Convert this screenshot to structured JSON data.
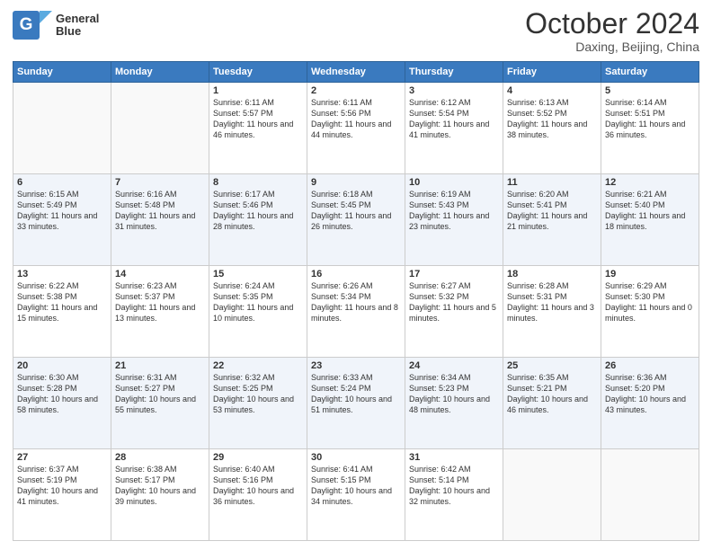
{
  "logo": {
    "line1": "General",
    "line2": "Blue"
  },
  "title": "October 2024",
  "location": "Daxing, Beijing, China",
  "headers": [
    "Sunday",
    "Monday",
    "Tuesday",
    "Wednesday",
    "Thursday",
    "Friday",
    "Saturday"
  ],
  "weeks": [
    [
      {
        "day": "",
        "info": ""
      },
      {
        "day": "",
        "info": ""
      },
      {
        "day": "1",
        "info": "Sunrise: 6:11 AM\nSunset: 5:57 PM\nDaylight: 11 hours and 46 minutes."
      },
      {
        "day": "2",
        "info": "Sunrise: 6:11 AM\nSunset: 5:56 PM\nDaylight: 11 hours and 44 minutes."
      },
      {
        "day": "3",
        "info": "Sunrise: 6:12 AM\nSunset: 5:54 PM\nDaylight: 11 hours and 41 minutes."
      },
      {
        "day": "4",
        "info": "Sunrise: 6:13 AM\nSunset: 5:52 PM\nDaylight: 11 hours and 38 minutes."
      },
      {
        "day": "5",
        "info": "Sunrise: 6:14 AM\nSunset: 5:51 PM\nDaylight: 11 hours and 36 minutes."
      }
    ],
    [
      {
        "day": "6",
        "info": "Sunrise: 6:15 AM\nSunset: 5:49 PM\nDaylight: 11 hours and 33 minutes."
      },
      {
        "day": "7",
        "info": "Sunrise: 6:16 AM\nSunset: 5:48 PM\nDaylight: 11 hours and 31 minutes."
      },
      {
        "day": "8",
        "info": "Sunrise: 6:17 AM\nSunset: 5:46 PM\nDaylight: 11 hours and 28 minutes."
      },
      {
        "day": "9",
        "info": "Sunrise: 6:18 AM\nSunset: 5:45 PM\nDaylight: 11 hours and 26 minutes."
      },
      {
        "day": "10",
        "info": "Sunrise: 6:19 AM\nSunset: 5:43 PM\nDaylight: 11 hours and 23 minutes."
      },
      {
        "day": "11",
        "info": "Sunrise: 6:20 AM\nSunset: 5:41 PM\nDaylight: 11 hours and 21 minutes."
      },
      {
        "day": "12",
        "info": "Sunrise: 6:21 AM\nSunset: 5:40 PM\nDaylight: 11 hours and 18 minutes."
      }
    ],
    [
      {
        "day": "13",
        "info": "Sunrise: 6:22 AM\nSunset: 5:38 PM\nDaylight: 11 hours and 15 minutes."
      },
      {
        "day": "14",
        "info": "Sunrise: 6:23 AM\nSunset: 5:37 PM\nDaylight: 11 hours and 13 minutes."
      },
      {
        "day": "15",
        "info": "Sunrise: 6:24 AM\nSunset: 5:35 PM\nDaylight: 11 hours and 10 minutes."
      },
      {
        "day": "16",
        "info": "Sunrise: 6:26 AM\nSunset: 5:34 PM\nDaylight: 11 hours and 8 minutes."
      },
      {
        "day": "17",
        "info": "Sunrise: 6:27 AM\nSunset: 5:32 PM\nDaylight: 11 hours and 5 minutes."
      },
      {
        "day": "18",
        "info": "Sunrise: 6:28 AM\nSunset: 5:31 PM\nDaylight: 11 hours and 3 minutes."
      },
      {
        "day": "19",
        "info": "Sunrise: 6:29 AM\nSunset: 5:30 PM\nDaylight: 11 hours and 0 minutes."
      }
    ],
    [
      {
        "day": "20",
        "info": "Sunrise: 6:30 AM\nSunset: 5:28 PM\nDaylight: 10 hours and 58 minutes."
      },
      {
        "day": "21",
        "info": "Sunrise: 6:31 AM\nSunset: 5:27 PM\nDaylight: 10 hours and 55 minutes."
      },
      {
        "day": "22",
        "info": "Sunrise: 6:32 AM\nSunset: 5:25 PM\nDaylight: 10 hours and 53 minutes."
      },
      {
        "day": "23",
        "info": "Sunrise: 6:33 AM\nSunset: 5:24 PM\nDaylight: 10 hours and 51 minutes."
      },
      {
        "day": "24",
        "info": "Sunrise: 6:34 AM\nSunset: 5:23 PM\nDaylight: 10 hours and 48 minutes."
      },
      {
        "day": "25",
        "info": "Sunrise: 6:35 AM\nSunset: 5:21 PM\nDaylight: 10 hours and 46 minutes."
      },
      {
        "day": "26",
        "info": "Sunrise: 6:36 AM\nSunset: 5:20 PM\nDaylight: 10 hours and 43 minutes."
      }
    ],
    [
      {
        "day": "27",
        "info": "Sunrise: 6:37 AM\nSunset: 5:19 PM\nDaylight: 10 hours and 41 minutes."
      },
      {
        "day": "28",
        "info": "Sunrise: 6:38 AM\nSunset: 5:17 PM\nDaylight: 10 hours and 39 minutes."
      },
      {
        "day": "29",
        "info": "Sunrise: 6:40 AM\nSunset: 5:16 PM\nDaylight: 10 hours and 36 minutes."
      },
      {
        "day": "30",
        "info": "Sunrise: 6:41 AM\nSunset: 5:15 PM\nDaylight: 10 hours and 34 minutes."
      },
      {
        "day": "31",
        "info": "Sunrise: 6:42 AM\nSunset: 5:14 PM\nDaylight: 10 hours and 32 minutes."
      },
      {
        "day": "",
        "info": ""
      },
      {
        "day": "",
        "info": ""
      }
    ]
  ]
}
